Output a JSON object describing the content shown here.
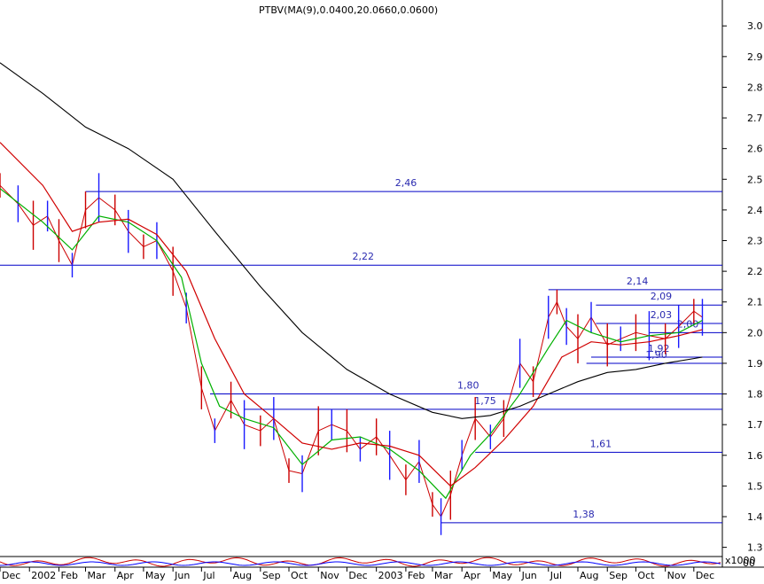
{
  "header": {
    "title": "PTBV(MA(9),0.0400,20.0660,0.0600)"
  },
  "colors": {
    "background": "#ffffff",
    "level_line": "#0000c8",
    "level_label": "#2a2ab0",
    "price_up": "#1a1aff",
    "price_down": "#cc0000",
    "ma_green": "#00b000",
    "ma_red": "#d00000",
    "ma_black": "#000000",
    "channel_green": "#008800",
    "indicator_red": "#cc0000",
    "indicator_blue": "#0000ff"
  },
  "chart_data": {
    "type": "line",
    "title": "PTBV(MA(9),0.0400,20.0660,0.0600)",
    "xlabel": "",
    "ylabel": "",
    "x_range": [
      "2001-12-01",
      "2003-12-31"
    ],
    "ylim": [
      1.27,
      3.07
    ],
    "y_ticks": [
      1.3,
      1.4,
      1.5,
      1.6,
      1.7,
      1.8,
      1.9,
      2.0,
      2.1,
      2.2,
      2.3,
      2.4,
      2.5,
      2.6,
      2.7,
      2.8,
      2.9,
      3.0
    ],
    "y_tick_labels": [
      "1.3",
      "1.4",
      "1.5",
      "1.6",
      "1.7",
      "1.8",
      "1.9",
      "2.0",
      "2.1",
      "2.2",
      "2.3",
      "2.4",
      "2.5",
      "2.6",
      "2.7",
      "2.8",
      "2.9",
      "3.0"
    ],
    "x_ticks": [
      {
        "date": "2001-12-01",
        "label": "Dec"
      },
      {
        "date": "2002-01-01",
        "label": "2002"
      },
      {
        "date": "2002-02-01",
        "label": "Feb"
      },
      {
        "date": "2002-03-01",
        "label": "Mar"
      },
      {
        "date": "2002-04-01",
        "label": "Apr"
      },
      {
        "date": "2002-05-01",
        "label": "May"
      },
      {
        "date": "2002-06-01",
        "label": "Jun"
      },
      {
        "date": "2002-07-01",
        "label": "Jul"
      },
      {
        "date": "2002-08-01",
        "label": "Aug"
      },
      {
        "date": "2002-09-01",
        "label": "Sep"
      },
      {
        "date": "2002-10-01",
        "label": "Oct"
      },
      {
        "date": "2002-11-01",
        "label": "Nov"
      },
      {
        "date": "2002-12-01",
        "label": "Dec"
      },
      {
        "date": "2003-01-01",
        "label": "2003"
      },
      {
        "date": "2003-02-01",
        "label": "Feb"
      },
      {
        "date": "2003-03-01",
        "label": "Mar"
      },
      {
        "date": "2003-04-01",
        "label": "Apr"
      },
      {
        "date": "2003-05-01",
        "label": "May"
      },
      {
        "date": "2003-06-01",
        "label": "Jun"
      },
      {
        "date": "2003-07-01",
        "label": "Jul"
      },
      {
        "date": "2003-08-01",
        "label": "Aug"
      },
      {
        "date": "2003-09-01",
        "label": "Sep"
      },
      {
        "date": "2003-10-01",
        "label": "Oct"
      },
      {
        "date": "2003-11-01",
        "label": "Nov"
      },
      {
        "date": "2003-12-01",
        "label": "Dec"
      }
    ],
    "scale_marker": "x1000",
    "indicator_axis_label": "00",
    "grid": false,
    "series": [
      {
        "style": "price-bars",
        "points": [
          [
            "2001-12-01",
            2.48
          ],
          [
            "2001-12-20",
            2.42
          ],
          [
            "2002-01-05",
            2.35
          ],
          [
            "2002-01-20",
            2.38
          ],
          [
            "2002-02-01",
            2.3
          ],
          [
            "2002-02-15",
            2.22
          ],
          [
            "2002-03-01",
            2.4
          ],
          [
            "2002-03-15",
            2.44
          ],
          [
            "2002-04-01",
            2.4
          ],
          [
            "2002-04-15",
            2.33
          ],
          [
            "2002-05-01",
            2.28
          ],
          [
            "2002-05-15",
            2.3
          ],
          [
            "2002-06-01",
            2.2
          ],
          [
            "2002-06-15",
            2.08
          ],
          [
            "2002-07-01",
            1.82
          ],
          [
            "2002-07-15",
            1.68
          ],
          [
            "2002-08-01",
            1.78
          ],
          [
            "2002-08-15",
            1.7
          ],
          [
            "2002-09-01",
            1.68
          ],
          [
            "2002-09-15",
            1.72
          ],
          [
            "2002-10-01",
            1.55
          ],
          [
            "2002-10-15",
            1.54
          ],
          [
            "2002-11-01",
            1.68
          ],
          [
            "2002-11-15",
            1.7
          ],
          [
            "2002-12-01",
            1.68
          ],
          [
            "2002-12-15",
            1.62
          ],
          [
            "2003-01-01",
            1.66
          ],
          [
            "2003-01-15",
            1.6
          ],
          [
            "2003-02-01",
            1.52
          ],
          [
            "2003-02-15",
            1.58
          ],
          [
            "2003-03-01",
            1.44
          ],
          [
            "2003-03-10",
            1.4
          ],
          [
            "2003-03-20",
            1.47
          ],
          [
            "2003-04-01",
            1.6
          ],
          [
            "2003-04-15",
            1.72
          ],
          [
            "2003-05-01",
            1.66
          ],
          [
            "2003-05-15",
            1.72
          ],
          [
            "2003-06-01",
            1.9
          ],
          [
            "2003-06-15",
            1.84
          ],
          [
            "2003-07-01",
            2.05
          ],
          [
            "2003-07-10",
            2.1
          ],
          [
            "2003-07-20",
            2.02
          ],
          [
            "2003-08-01",
            1.98
          ],
          [
            "2003-08-15",
            2.05
          ],
          [
            "2003-09-01",
            1.96
          ],
          [
            "2003-09-15",
            1.98
          ],
          [
            "2003-10-01",
            2.0
          ],
          [
            "2003-10-15",
            1.99
          ],
          [
            "2003-11-01",
            1.98
          ],
          [
            "2003-11-15",
            2.02
          ],
          [
            "2003-12-01",
            2.07
          ],
          [
            "2003-12-10",
            2.05
          ]
        ]
      },
      {
        "style": "ma-green",
        "points": [
          [
            "2001-12-01",
            2.47
          ],
          [
            "2002-01-15",
            2.36
          ],
          [
            "2002-02-15",
            2.27
          ],
          [
            "2002-03-15",
            2.38
          ],
          [
            "2002-04-15",
            2.36
          ],
          [
            "2002-05-15",
            2.3
          ],
          [
            "2002-06-10",
            2.18
          ],
          [
            "2002-07-01",
            1.9
          ],
          [
            "2002-07-20",
            1.76
          ],
          [
            "2002-08-15",
            1.72
          ],
          [
            "2002-09-15",
            1.69
          ],
          [
            "2002-10-15",
            1.57
          ],
          [
            "2002-11-15",
            1.65
          ],
          [
            "2002-12-15",
            1.66
          ],
          [
            "2003-01-15",
            1.62
          ],
          [
            "2003-02-15",
            1.55
          ],
          [
            "2003-03-15",
            1.46
          ],
          [
            "2003-04-10",
            1.6
          ],
          [
            "2003-05-01",
            1.67
          ],
          [
            "2003-06-01",
            1.8
          ],
          [
            "2003-07-01",
            1.95
          ],
          [
            "2003-07-20",
            2.04
          ],
          [
            "2003-08-15",
            2.0
          ],
          [
            "2003-09-15",
            1.97
          ],
          [
            "2003-10-15",
            1.99
          ],
          [
            "2003-11-15",
            2.0
          ],
          [
            "2003-12-10",
            2.04
          ]
        ]
      },
      {
        "style": "ma-red",
        "points": [
          [
            "2001-12-01",
            2.62
          ],
          [
            "2002-01-15",
            2.48
          ],
          [
            "2002-02-15",
            2.33
          ],
          [
            "2002-03-15",
            2.36
          ],
          [
            "2002-04-15",
            2.37
          ],
          [
            "2002-05-15",
            2.32
          ],
          [
            "2002-06-15",
            2.2
          ],
          [
            "2002-07-15",
            1.98
          ],
          [
            "2002-08-15",
            1.8
          ],
          [
            "2002-09-15",
            1.72
          ],
          [
            "2002-10-15",
            1.64
          ],
          [
            "2002-11-15",
            1.62
          ],
          [
            "2002-12-15",
            1.64
          ],
          [
            "2003-01-15",
            1.63
          ],
          [
            "2003-02-15",
            1.6
          ],
          [
            "2003-03-20",
            1.5
          ],
          [
            "2003-04-15",
            1.56
          ],
          [
            "2003-05-15",
            1.65
          ],
          [
            "2003-06-15",
            1.76
          ],
          [
            "2003-07-15",
            1.92
          ],
          [
            "2003-08-15",
            1.97
          ],
          [
            "2003-09-15",
            1.96
          ],
          [
            "2003-10-15",
            1.97
          ],
          [
            "2003-11-15",
            1.99
          ],
          [
            "2003-12-10",
            2.01
          ]
        ]
      },
      {
        "style": "ma-black",
        "points": [
          [
            "2001-12-01",
            2.88
          ],
          [
            "2002-01-15",
            2.78
          ],
          [
            "2002-03-01",
            2.67
          ],
          [
            "2002-04-15",
            2.6
          ],
          [
            "2002-06-01",
            2.5
          ],
          [
            "2002-07-15",
            2.33
          ],
          [
            "2002-09-01",
            2.15
          ],
          [
            "2002-10-15",
            2.0
          ],
          [
            "2002-12-01",
            1.88
          ],
          [
            "2003-01-15",
            1.8
          ],
          [
            "2003-03-01",
            1.74
          ],
          [
            "2003-04-01",
            1.72
          ],
          [
            "2003-05-01",
            1.73
          ],
          [
            "2003-06-01",
            1.76
          ],
          [
            "2003-07-01",
            1.8
          ],
          [
            "2003-08-01",
            1.84
          ],
          [
            "2003-09-01",
            1.87
          ],
          [
            "2003-10-01",
            1.88
          ],
          [
            "2003-11-01",
            1.9
          ],
          [
            "2003-12-10",
            1.92
          ]
        ]
      }
    ],
    "levels": [
      {
        "value": 2.46,
        "label": "2,46",
        "start": "2002-03-01"
      },
      {
        "value": 2.22,
        "label": "2,22",
        "start": "2001-12-01"
      },
      {
        "value": 2.14,
        "label": "2,14",
        "start": "2003-07-01"
      },
      {
        "value": 2.09,
        "label": "2,09",
        "start": "2003-08-20"
      },
      {
        "value": 2.03,
        "label": "2,03",
        "start": "2003-08-20"
      },
      {
        "value": 2.0,
        "label": "2,00",
        "start": "2003-10-15"
      },
      {
        "value": 1.92,
        "label": "1,92",
        "start": "2003-08-15"
      },
      {
        "value": 1.9,
        "label": "1,90",
        "start": "2003-08-10"
      },
      {
        "value": 1.8,
        "label": "1,80",
        "start": "2002-07-10"
      },
      {
        "value": 1.75,
        "label": "1,75",
        "start": "2002-08-15"
      },
      {
        "value": 1.61,
        "label": "1,61",
        "start": "2003-04-15"
      },
      {
        "value": 1.38,
        "label": "1,38",
        "start": "2003-03-10"
      }
    ]
  }
}
